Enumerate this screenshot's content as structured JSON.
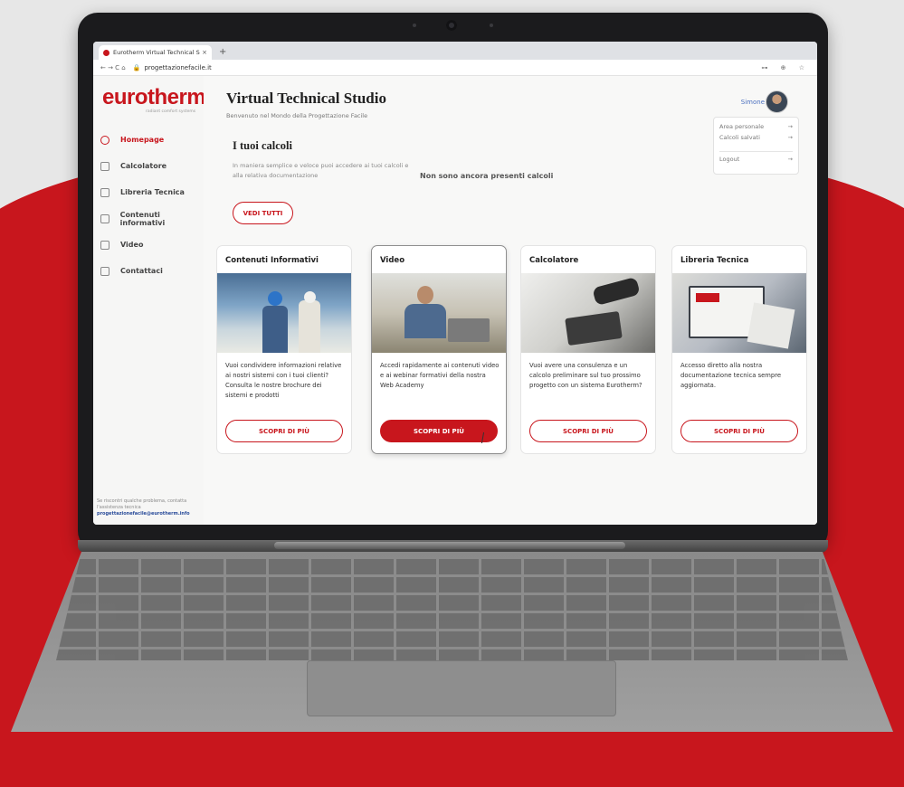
{
  "browser": {
    "tab_title": "Eurotherm Virtual Technical S",
    "tab_close": "×",
    "new_tab": "+",
    "nav_icons": "← → C ⌂",
    "lock_icon": "🔒",
    "url": "progettazionefacile.it",
    "right_icons": "⊶ ⊕ ☆"
  },
  "sidebar": {
    "logo": "eurotherm",
    "tagline": "radiant comfort systems",
    "items": [
      {
        "label": "Homepage",
        "icon": "home-icon",
        "active": true
      },
      {
        "label": "Calcolatore",
        "icon": "calculator-icon"
      },
      {
        "label": "Libreria Tecnica",
        "icon": "library-icon"
      },
      {
        "label": "Contenuti informativi",
        "icon": "document-icon"
      },
      {
        "label": "Video",
        "icon": "play-icon"
      },
      {
        "label": "Contattaci",
        "icon": "phone-icon"
      }
    ],
    "footer_text": "Se riscontri qualche problema, contatta l'assistenza tecnica",
    "footer_email": "progettazionefacile@eurotherm.info"
  },
  "header": {
    "title": "Virtual Technical Studio",
    "subtitle": "Benvenuto nel Mondo della Progettazione Facile",
    "user_name": "Simone"
  },
  "user_menu": {
    "items": [
      "Area personale",
      "Calcoli salvati",
      "Logout"
    ],
    "arrow": "→"
  },
  "calcoli": {
    "title": "I tuoi calcoli",
    "description": "In maniera semplice e veloce puoi accedere ai tuoi calcoli e alla relativa documentazione",
    "empty_message": "Non sono ancora presenti calcoli",
    "button": "VEDI TUTTI"
  },
  "cards": [
    {
      "title": "Contenuti Informativi",
      "text": "Vuoi condividere informazioni relative ai nostri sistemi con i tuoi clienti? Consulta le nostre brochure dei sistemi e prodotti",
      "button": "SCOPRI DI PIÙ"
    },
    {
      "title": "Video",
      "text": "Accedi rapidamente ai contenuti video e ai webinar formativi della nostra Web Academy",
      "button": "SCOPRI DI PIÙ"
    },
    {
      "title": "Calcolatore",
      "text": "Vuoi avere una consulenza e un calcolo preliminare sul tuo prossimo progetto con un sistema Eurotherm?",
      "button": "SCOPRI DI PIÙ"
    },
    {
      "title": "Libreria Tecnica",
      "text": "Accesso diretto alla nostra documentazione tecnica sempre aggiornata.",
      "button": "SCOPRI DI PIÙ"
    }
  ],
  "colors": {
    "brand": "#c8161d",
    "link": "#4a6fbf"
  }
}
